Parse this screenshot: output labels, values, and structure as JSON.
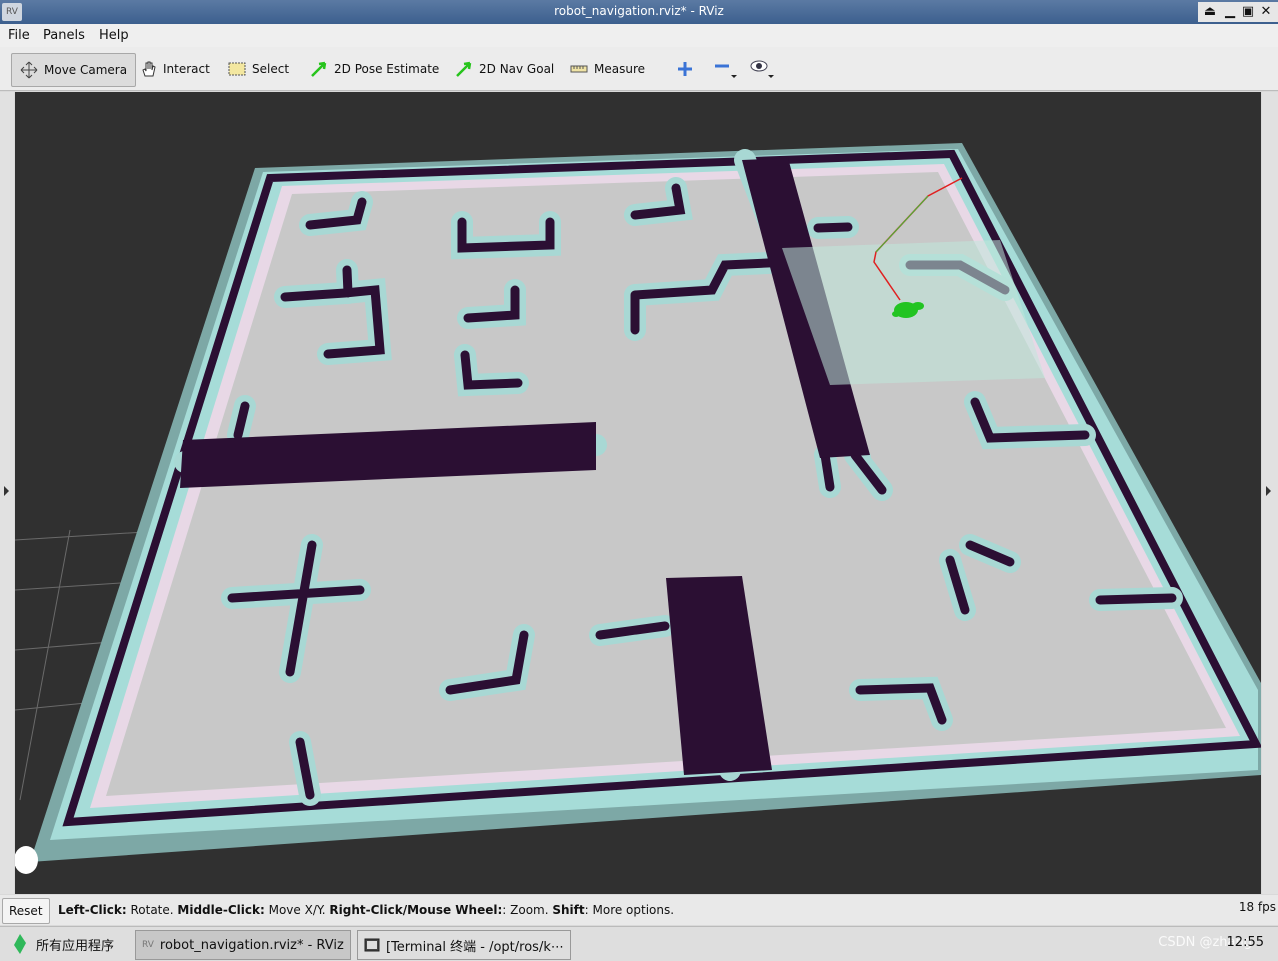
{
  "window": {
    "title": "robot_navigation.rviz* - RViz",
    "app_icon_label": "RV"
  },
  "window_controls": {
    "shade": "⏏",
    "minimize": "▁",
    "maximize": "▣",
    "close": "✕"
  },
  "menu": {
    "items": [
      "File",
      "Panels",
      "Help"
    ]
  },
  "toolbar": {
    "tools": [
      {
        "label": "Move Camera",
        "icon": "move-camera-icon",
        "active": true
      },
      {
        "label": "Interact",
        "icon": "hand-icon"
      },
      {
        "label": "Select",
        "icon": "select-box-icon"
      },
      {
        "label": "2D Pose Estimate",
        "icon": "green-arrow-icon"
      },
      {
        "label": "2D Nav Goal",
        "icon": "green-arrow-icon"
      },
      {
        "label": "Measure",
        "icon": "ruler-icon"
      }
    ],
    "extra_icons": [
      "plus-icon",
      "minus-icon",
      "eye-icon"
    ]
  },
  "status": {
    "reset_label": "Reset",
    "hint": [
      {
        "bold": "Left-Click:",
        "text": " Rotate. "
      },
      {
        "bold": "Middle-Click:",
        "text": " Move X/Y. "
      },
      {
        "bold": "Right-Click/Mouse Wheel:",
        "text": ": Zoom. "
      },
      {
        "bold": "Shift",
        "text": ": More options."
      }
    ],
    "fps": "18 fps"
  },
  "taskbar": {
    "start_label": "所有应用程序",
    "tasks": [
      {
        "label": "robot_navigation.rviz* - RViz",
        "active": true
      },
      {
        "label": "[Terminal 终端 - /opt/ros/k⋯"
      }
    ],
    "watermark": "CSDN @zhang",
    "clock": "12:55"
  },
  "colors": {
    "viewport_bg": "#303030",
    "map_free": "#c8c8c8",
    "map_wall": "#2b0f33",
    "inflation": "#a8d8d4",
    "robot": "#22c422"
  }
}
